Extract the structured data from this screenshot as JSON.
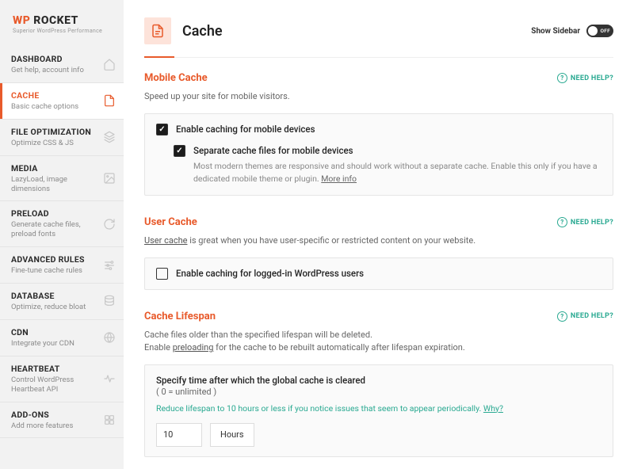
{
  "brand": {
    "name_part1": "WP",
    "name_part2": " ROCKET",
    "tagline": "Superior WordPress Performance"
  },
  "page": {
    "title": "Cache",
    "show_sidebar_label": "Show Sidebar",
    "toggle_state": "OFF"
  },
  "nav": [
    {
      "title": "DASHBOARD",
      "sub": "Get help, account info",
      "icon": "home"
    },
    {
      "title": "CACHE",
      "sub": "Basic cache options",
      "icon": "doc",
      "active": true
    },
    {
      "title": "FILE OPTIMIZATION",
      "sub": "Optimize CSS & JS",
      "icon": "layers"
    },
    {
      "title": "MEDIA",
      "sub": "LazyLoad, image dimensions",
      "icon": "image"
    },
    {
      "title": "PRELOAD",
      "sub": "Generate cache files, preload fonts",
      "icon": "refresh"
    },
    {
      "title": "ADVANCED RULES",
      "sub": "Fine-tune cache rules",
      "icon": "sliders"
    },
    {
      "title": "DATABASE",
      "sub": "Optimize, reduce bloat",
      "icon": "db"
    },
    {
      "title": "CDN",
      "sub": "Integrate your CDN",
      "icon": "globe"
    },
    {
      "title": "HEARTBEAT",
      "sub": "Control WordPress Heartbeat API",
      "icon": "heart"
    },
    {
      "title": "ADD-ONS",
      "sub": "Add more features",
      "icon": "puzzle"
    }
  ],
  "help_label": "NEED HELP?",
  "sections": {
    "mobile": {
      "title": "Mobile Cache",
      "desc": "Speed up your site for mobile visitors.",
      "opt1": "Enable caching for mobile devices",
      "opt2": "Separate cache files for mobile devices",
      "hint": "Most modern themes are responsive and should work without a separate cache. Enable this only if you have a dedicated mobile theme or plugin. ",
      "more": "More info"
    },
    "user": {
      "title": "User Cache",
      "desc_prefix": "User cache",
      "desc_rest": " is great when you have user-specific or restricted content on your website.",
      "opt1": "Enable caching for logged-in WordPress users"
    },
    "lifespan": {
      "title": "Cache Lifespan",
      "desc1": "Cache files older than the specified lifespan will be deleted.",
      "desc2_pre": "Enable ",
      "desc2_link": "preloading",
      "desc2_post": " for the cache to be rebuilt automatically after lifespan expiration.",
      "box_title": "Specify time after which the global cache is cleared",
      "box_sub": "( 0 = unlimited )",
      "tip": "Reduce lifespan to 10 hours or less if you notice issues that seem to appear periodically. ",
      "tip_link": "Why?",
      "value": "10",
      "unit": "Hours"
    }
  }
}
